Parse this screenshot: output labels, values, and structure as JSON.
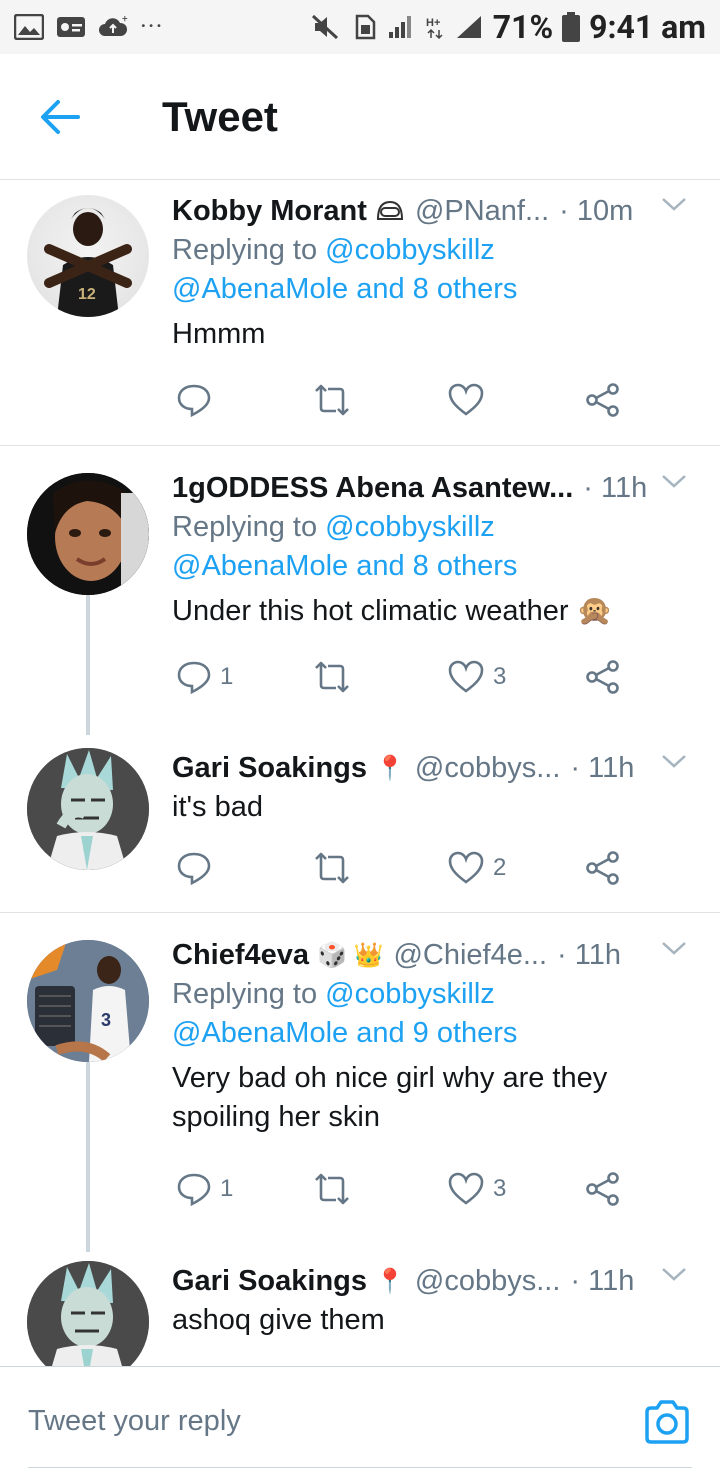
{
  "status_bar": {
    "battery": "71%",
    "time": "9:41 am",
    "network": "H+",
    "more": "···"
  },
  "header": {
    "title": "Tweet"
  },
  "tweets": [
    {
      "name": "Kobby Morant",
      "handle": "@PNanf...",
      "time": "· 10m",
      "reply_prefix": "Replying to ",
      "reply_to": "@cobbyskillz",
      "reply_others": "@AbenaMole and 8 others",
      "text": "Hmmm",
      "reply_count": "",
      "retweet_count": "",
      "like_count": ""
    },
    {
      "name": "1gODDESS Abena Asantew...",
      "handle": "",
      "time": "· 11h",
      "reply_prefix": "Replying to ",
      "reply_to": "@cobbyskillz",
      "reply_others": "@AbenaMole and 8 others",
      "text": "Under this hot climatic weather 🙊",
      "reply_count": "1",
      "retweet_count": "",
      "like_count": "3"
    },
    {
      "name": "Gari Soakings",
      "emoji": "📍",
      "handle": "@cobbys...",
      "time": "· 11h",
      "text": "it's bad",
      "reply_count": "",
      "retweet_count": "",
      "like_count": "2"
    },
    {
      "name": "Chief4eva",
      "emoji": "🎲 👑",
      "handle": "@Chief4e...",
      "time": "· 11h",
      "reply_prefix": "Replying to ",
      "reply_to": "@cobbyskillz",
      "reply_others": "@AbenaMole and 9 others",
      "text": "Very bad oh nice girl why are they spoiling her skin",
      "reply_count": "1",
      "retweet_count": "",
      "like_count": "3"
    },
    {
      "name": "Gari Soakings",
      "emoji": "📍",
      "handle": "@cobbys...",
      "time": "· 11h",
      "text": "ashoq give them"
    }
  ],
  "composer": {
    "placeholder": "Tweet your reply"
  },
  "colors": {
    "accent": "#1da1f2",
    "secondary_text": "#657786",
    "divider": "#dfe3e6"
  }
}
